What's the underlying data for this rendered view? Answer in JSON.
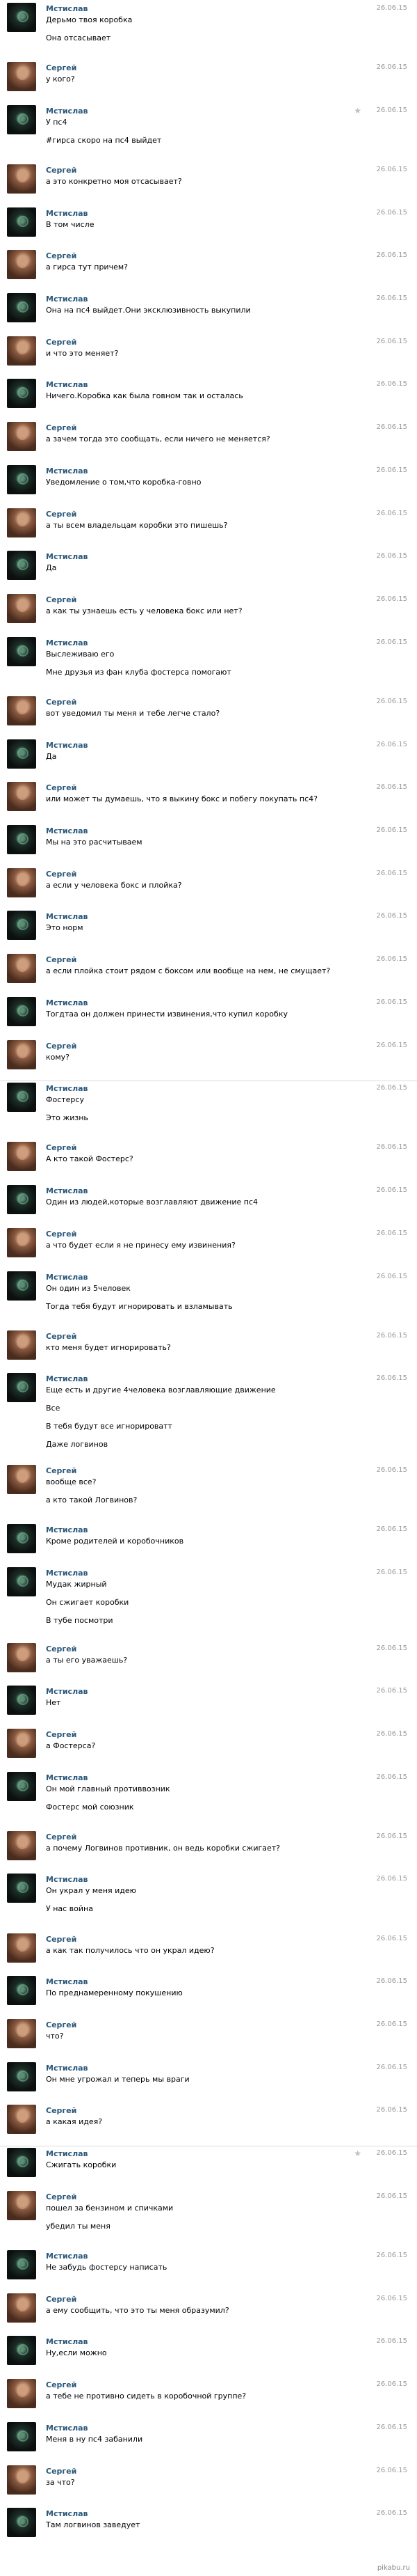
{
  "names": {
    "sergey": "Сергей",
    "mstislav": "Мстислав"
  },
  "date": "26.06.15",
  "messages": [
    {
      "who": "mstislav",
      "texts": [
        "Дерьмо твоя коробка",
        "Она отсасывает"
      ]
    },
    {
      "who": "sergey",
      "texts": [
        "у кого?"
      ]
    },
    {
      "who": "mstislav",
      "star": true,
      "texts": [
        "У пс4",
        "#гирса скоро на пс4 выйдет"
      ]
    },
    {
      "who": "sergey",
      "texts": [
        "а это конкретно моя отсасывает?"
      ]
    },
    {
      "who": "mstislav",
      "texts": [
        "В том числе"
      ]
    },
    {
      "who": "sergey",
      "texts": [
        "а гирса тут причем?"
      ]
    },
    {
      "who": "mstislav",
      "texts": [
        "Она на пс4 выйдет.Они эксклюзивность выкупили"
      ]
    },
    {
      "who": "sergey",
      "texts": [
        "и что это меняет?"
      ]
    },
    {
      "who": "mstislav",
      "texts": [
        "Ничего.Коробка как была говном так и осталась"
      ]
    },
    {
      "who": "sergey",
      "texts": [
        "а зачем тогда это сообщать, если ничего не меняется?"
      ]
    },
    {
      "who": "mstislav",
      "texts": [
        "Уведомление о том,что коробка-говно"
      ]
    },
    {
      "who": "sergey",
      "texts": [
        "а ты всем владельцам коробки это пишешь?"
      ]
    },
    {
      "who": "mstislav",
      "texts": [
        "Да"
      ]
    },
    {
      "who": "sergey",
      "texts": [
        "а как ты узнаешь есть у человека бокс или нет?"
      ]
    },
    {
      "who": "mstislav",
      "texts": [
        "Выслеживаю его",
        "Мне друзья из фан клуба фостерса помогают"
      ]
    },
    {
      "who": "sergey",
      "texts": [
        "вот уведомил ты меня и тебе легче стало?"
      ]
    },
    {
      "who": "mstislav",
      "texts": [
        "Да"
      ]
    },
    {
      "who": "sergey",
      "texts": [
        "или может ты думаешь, что я выкину бокс и побегу покупать пс4?"
      ]
    },
    {
      "who": "mstislav",
      "texts": [
        "Мы на это расчитываем"
      ]
    },
    {
      "who": "sergey",
      "texts": [
        "а если у человека бокс и плойка?"
      ]
    },
    {
      "who": "mstislav",
      "texts": [
        "Это норм"
      ]
    },
    {
      "who": "sergey",
      "texts": [
        "а если плойка стоит рядом с боксом или вообще на нем, не смущает?"
      ]
    },
    {
      "who": "mstislav",
      "texts": [
        "Тогдтаа он должен принести извинения,что купил коробку"
      ]
    },
    {
      "who": "sergey",
      "texts": [
        "кому?"
      ],
      "sep": true
    },
    {
      "who": "mstislav",
      "texts": [
        "Фостерсу",
        "Это жизнь"
      ]
    },
    {
      "who": "sergey",
      "texts": [
        "А кто такой Фостерс?"
      ]
    },
    {
      "who": "mstislav",
      "texts": [
        "Один из людей,которые возглавляют движение пс4"
      ]
    },
    {
      "who": "sergey",
      "texts": [
        "а что будет если я не принесу ему извинения?"
      ]
    },
    {
      "who": "mstislav",
      "texts": [
        "Он один из 5человек",
        "Тогда тебя будут игнорировать и взламывать"
      ]
    },
    {
      "who": "sergey",
      "texts": [
        "кто меня будет игнорировать?"
      ]
    },
    {
      "who": "mstislav",
      "texts": [
        "Еще есть и другие 4человека возглавляющие движение",
        "Все",
        "В тебя будут все игнорироватт",
        "Даже логвинов"
      ]
    },
    {
      "who": "sergey",
      "texts": [
        "вообще все?",
        "а кто такой Логвинов?"
      ]
    },
    {
      "who": "mstislav",
      "texts": [
        "Кроме родителей и коробочников"
      ]
    },
    {
      "who": "mstislav",
      "texts": [
        "Мудак жирный",
        "Он сжигает коробки",
        "В тубе посмотри"
      ]
    },
    {
      "who": "sergey",
      "texts": [
        "а ты его уважаешь?"
      ]
    },
    {
      "who": "mstislav",
      "texts": [
        "Нет"
      ]
    },
    {
      "who": "sergey",
      "texts": [
        "а Фостерса?"
      ]
    },
    {
      "who": "mstislav",
      "texts": [
        "Он мой главный противвозник",
        "Фостерс мой союзник"
      ]
    },
    {
      "who": "sergey",
      "texts": [
        "а почему Логвинов противник, он ведь коробки сжигает?"
      ]
    },
    {
      "who": "mstislav",
      "texts": [
        "Он украл у меня идею",
        "У нас война"
      ]
    },
    {
      "who": "sergey",
      "texts": [
        "а как так получилось что он украл идею?"
      ]
    },
    {
      "who": "mstislav",
      "texts": [
        "По преднамеренному покушению"
      ]
    },
    {
      "who": "sergey",
      "texts": [
        "что?"
      ]
    },
    {
      "who": "mstislav",
      "texts": [
        "Он мне угрожал и теперь мы враги"
      ]
    },
    {
      "who": "sergey",
      "texts": [
        "а какая идея?"
      ],
      "sep": true
    },
    {
      "who": "mstislav",
      "star": true,
      "texts": [
        "Сжигать коробки"
      ]
    },
    {
      "who": "sergey",
      "texts": [
        "пошел за бензином и спичками",
        "убедил ты меня"
      ]
    },
    {
      "who": "mstislav",
      "texts": [
        "Не забудь фостерсу написать"
      ]
    },
    {
      "who": "sergey",
      "texts": [
        "а ему сообщить, что это ты меня образумил?"
      ]
    },
    {
      "who": "mstislav",
      "texts": [
        "Ну,если можно"
      ]
    },
    {
      "who": "sergey",
      "texts": [
        "а тебе не противно сидеть в коробочной группе?"
      ]
    },
    {
      "who": "mstislav",
      "texts": [
        "Меня в ну пс4 забанили"
      ]
    },
    {
      "who": "sergey",
      "texts": [
        "за что?"
      ]
    },
    {
      "who": "mstislav",
      "texts": [
        "Там логвинов заведует"
      ]
    }
  ],
  "footer": "pikabu.ru"
}
